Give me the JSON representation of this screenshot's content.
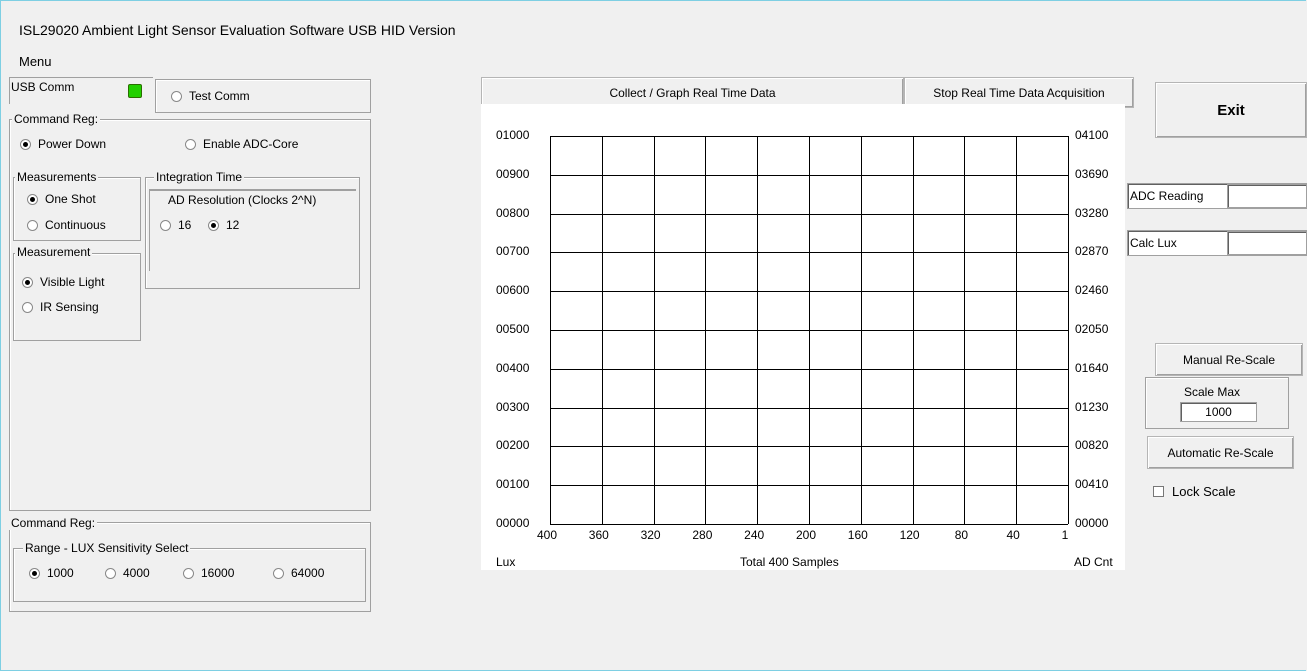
{
  "window": {
    "title": "ISL29020  Ambient Light Sensor Evaluation Software USB HID Version",
    "menu": "Menu"
  },
  "usb": {
    "label": "USB Comm",
    "led_color": "#22d000",
    "test_comm": "Test Comm"
  },
  "command_reg1": {
    "legend": "Command Reg:",
    "power_down": "Power Down",
    "enable_adc": "Enable ADC-Core",
    "selected": "Power Down"
  },
  "measurements": {
    "legend": "Measurements",
    "one_shot": "One Shot",
    "continuous": "Continuous",
    "selected": "One Shot"
  },
  "integration": {
    "legend": "Integration Time",
    "ad_res_title": "AD Resolution (Clocks 2^N)",
    "opt16": "16",
    "opt12": "12",
    "selected": "12"
  },
  "measurement": {
    "legend": "Measurement",
    "visible": "Visible Light",
    "ir": "IR Sensing",
    "selected": "Visible Light"
  },
  "command_reg2": {
    "legend": "Command Reg:",
    "range_legend": "Range - LUX Sensitivity Select",
    "options": [
      "1000",
      "4000",
      "16000",
      "64000"
    ],
    "selected": "1000"
  },
  "buttons": {
    "collect": "Collect / Graph Real Time Data",
    "stop": "Stop Real Time Data Acquisition",
    "exit": "Exit",
    "manual": "Manual Re-Scale",
    "automatic": "Automatic Re-Scale"
  },
  "readings": {
    "adc_label": "ADC Reading",
    "adc_value": "",
    "lux_label": "Calc Lux",
    "lux_value": ""
  },
  "scale": {
    "legend": "Scale Max",
    "value": "1000",
    "lock_label": "Lock Scale",
    "locked": false
  },
  "chart_data": {
    "type": "line",
    "left_ticks": [
      "01000",
      "00900",
      "00800",
      "00700",
      "00600",
      "00500",
      "00400",
      "00300",
      "00200",
      "00100",
      "00000"
    ],
    "right_ticks": [
      "04100",
      "03690",
      "03280",
      "02870",
      "02460",
      "02050",
      "01640",
      "01230",
      "00820",
      "00410",
      "00000"
    ],
    "x_ticks": [
      "400",
      "360",
      "320",
      "280",
      "240",
      "200",
      "160",
      "120",
      "80",
      "40",
      "1"
    ],
    "left_label": "Lux",
    "right_label": "AD Cnt",
    "xlabel": "Total 400 Samples",
    "ylim": [
      0,
      1000
    ],
    "ylim_right": [
      0,
      4100
    ],
    "xlim": [
      400,
      1
    ],
    "grid": true,
    "series": []
  }
}
